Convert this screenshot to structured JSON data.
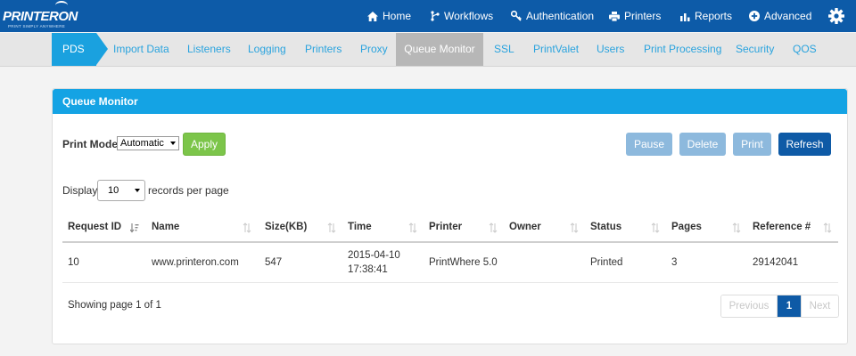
{
  "brand": {
    "name": "PRINTERON",
    "tagline": "PRINT SIMPLY ANYWHERE"
  },
  "topnav": {
    "home": "Home",
    "workflows": "Workflows",
    "authentication": "Authentication",
    "printers": "Printers",
    "reports": "Reports",
    "advanced": "Advanced"
  },
  "tabs": {
    "pds": "PDS",
    "import_data": "Import Data",
    "listeners": "Listeners",
    "logging": "Logging",
    "printers": "Printers",
    "proxy": "Proxy",
    "queue_monitor": "Queue Monitor",
    "ssl": "SSL",
    "printvalet": "PrintValet",
    "users": "Users",
    "print_processing": "Print Processing",
    "security": "Security",
    "qos": "QOS"
  },
  "panel": {
    "title": "Queue Monitor",
    "print_mode_label": "Print Mode",
    "print_mode_value": "Automatic",
    "apply": "Apply",
    "pause": "Pause",
    "delete": "Delete",
    "print": "Print",
    "refresh": "Refresh",
    "display_label": "Display",
    "display_value": "10",
    "records_label": "records per page"
  },
  "table": {
    "headers": {
      "request_id": "Request ID",
      "name": "Name",
      "size": "Size(KB)",
      "time": "Time",
      "printer": "Printer",
      "owner": "Owner",
      "status": "Status",
      "pages": "Pages",
      "reference": "Reference #"
    },
    "rows": [
      {
        "request_id": "10",
        "name": "www.printeron.com",
        "size": "547",
        "time_date": "2015-04-10",
        "time_clock": "17:38:41",
        "printer": "PrintWhere 5.0",
        "owner": "",
        "status": "Printed",
        "pages": "3",
        "reference": "29142041"
      }
    ]
  },
  "footer": {
    "showing": "Showing page 1 of 1",
    "previous": "Previous",
    "page": "1",
    "next": "Next"
  },
  "colors": {
    "topbar": "#0d5ba8",
    "accent": "#14a3e4",
    "apply_green": "#7cc54a",
    "refresh_blue": "#0e5aa6",
    "disabled_blue": "#8db9dd"
  },
  "icons": {
    "home": "home-icon",
    "workflows": "workflow-icon",
    "authentication": "key-icon",
    "printers": "printer-icon",
    "reports": "bar-chart-icon",
    "advanced": "plus-circle-icon",
    "settings": "gear-icon"
  }
}
